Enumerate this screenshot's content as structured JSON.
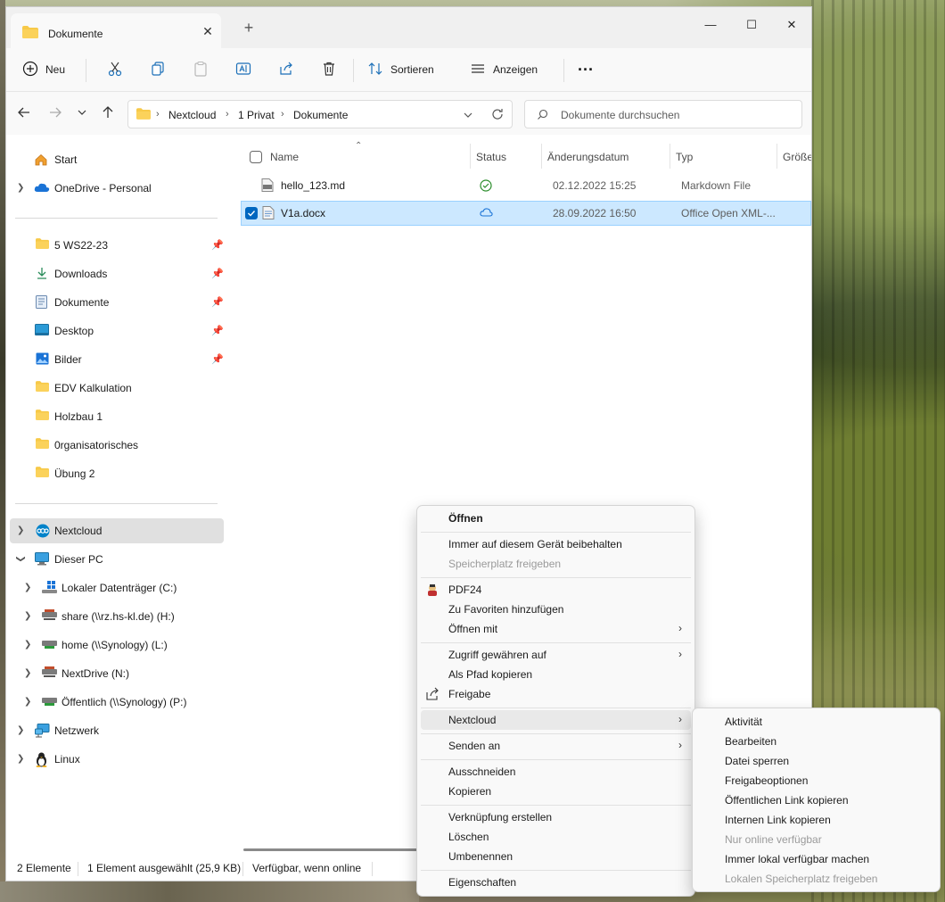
{
  "window": {
    "tab_title": "Dokumente",
    "tab_close": "✕",
    "new_tab": "+",
    "minimize": "—",
    "maximize": "☐",
    "close": "✕"
  },
  "toolbar": {
    "new_label": "Neu",
    "sort_label": "Sortieren",
    "view_label": "Anzeigen",
    "more": "···"
  },
  "address": {
    "crumbs": [
      "Nextcloud",
      "1 Privat",
      "Dokumente"
    ],
    "separator": "›",
    "search_placeholder": "Dokumente durchsuchen"
  },
  "sidebar": {
    "top": [
      {
        "label": "Start"
      },
      {
        "label": "OneDrive - Personal"
      }
    ],
    "quick": [
      {
        "label": "5 WS22-23",
        "pinned": true
      },
      {
        "label": "Downloads",
        "pinned": true
      },
      {
        "label": "Dokumente",
        "pinned": true
      },
      {
        "label": "Desktop",
        "pinned": true
      },
      {
        "label": "Bilder",
        "pinned": true
      },
      {
        "label": "EDV Kalkulation",
        "pinned": false
      },
      {
        "label": "Holzbau 1",
        "pinned": false
      },
      {
        "label": "0rganisatorisches",
        "pinned": false
      },
      {
        "label": "Übung 2",
        "pinned": false
      }
    ],
    "bottom": [
      {
        "label": "Nextcloud"
      },
      {
        "label": "Dieser PC"
      },
      {
        "label": "Lokaler Datenträger (C:)"
      },
      {
        "label": "share (\\\\rz.hs-kl.de) (H:)"
      },
      {
        "label": "home (\\\\Synology) (L:)"
      },
      {
        "label": "NextDrive (N:)"
      },
      {
        "label": "Öffentlich (\\\\Synology) (P:)"
      },
      {
        "label": "Netzwerk"
      },
      {
        "label": "Linux"
      }
    ]
  },
  "files": {
    "columns": [
      "Name",
      "Status",
      "Änderungsdatum",
      "Typ",
      "Größe"
    ],
    "rows": [
      {
        "name": "hello_123.md",
        "date": "02.12.2022 15:25",
        "type": "Markdown File",
        "status": "synced"
      },
      {
        "name": "V1a.docx",
        "date": "28.09.2022 16:50",
        "type": "Office Open XML-...",
        "status": "online"
      }
    ]
  },
  "statusbar": {
    "count": "2 Elemente",
    "selected": "1 Element ausgewählt (25,9 KB)",
    "availability": "Verfügbar, wenn online"
  },
  "context_menu": {
    "items": [
      {
        "label": "Öffnen",
        "bold": true
      },
      {
        "label": "Immer auf diesem Gerät beibehalten"
      },
      {
        "label": "Speicherplatz freigeben",
        "disabled": true
      },
      {
        "label": "PDF24",
        "icon": "pdf24-icon"
      },
      {
        "label": "Zu Favoriten hinzufügen"
      },
      {
        "label": "Öffnen mit",
        "submenu": true
      },
      {
        "label": "Zugriff gewähren auf",
        "submenu": true
      },
      {
        "label": "Als Pfad kopieren"
      },
      {
        "label": "Freigabe",
        "icon": "share-icon"
      },
      {
        "label": "Nextcloud",
        "submenu": true
      },
      {
        "label": "Senden an",
        "submenu": true
      },
      {
        "label": "Ausschneiden"
      },
      {
        "label": "Kopieren"
      },
      {
        "label": "Verknüpfung erstellen"
      },
      {
        "label": "Löschen"
      },
      {
        "label": "Umbenennen"
      },
      {
        "label": "Eigenschaften"
      }
    ],
    "arrow": "›"
  },
  "nextcloud_submenu": {
    "items": [
      {
        "label": "Aktivität"
      },
      {
        "label": "Bearbeiten"
      },
      {
        "label": "Datei sperren"
      },
      {
        "label": "Freigabeoptionen"
      },
      {
        "label": "Öffentlichen Link kopieren"
      },
      {
        "label": "Internen Link kopieren"
      },
      {
        "label": "Nur online verfügbar",
        "disabled": true
      },
      {
        "label": "Immer lokal verfügbar machen"
      },
      {
        "label": "Lokalen Speicherplatz freigeben",
        "disabled": true
      }
    ]
  },
  "colors": {
    "accent": "#0067c0",
    "selection": "#cce8ff",
    "folder": "#f7c948",
    "synced": "#2a8c2a"
  }
}
